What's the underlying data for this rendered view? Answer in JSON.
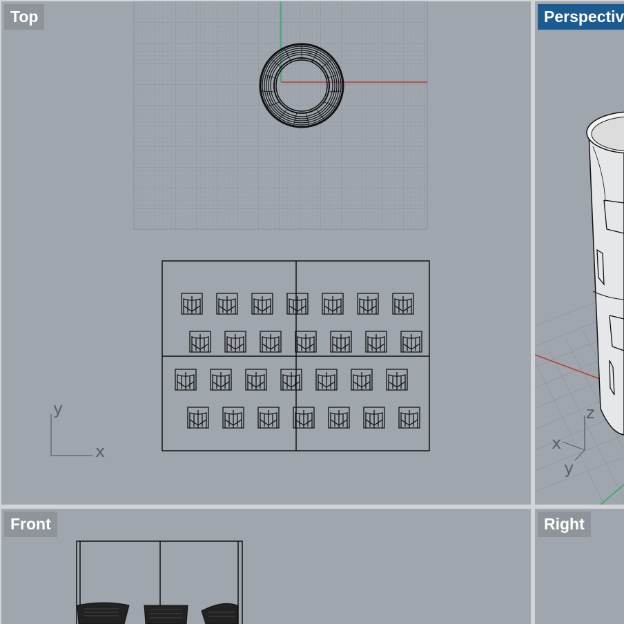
{
  "viewports": {
    "top": {
      "label": "Top",
      "active": false
    },
    "perspective": {
      "label": "Perspective",
      "active": true
    },
    "front": {
      "label": "Front",
      "active": false
    },
    "right": {
      "label": "Right",
      "active": false
    }
  },
  "axis_labels": {
    "top_x": "x",
    "top_y": "y",
    "persp_x": "x",
    "persp_y": "y",
    "persp_z": "z"
  },
  "colors": {
    "viewport_bg": "#a0a6ae",
    "active_label": "#1c5b92",
    "inactive_label": "#8f949a",
    "x_axis": "#c0392b",
    "y_axis": "#27ae60"
  },
  "pattern": {
    "rows": 4,
    "cells_per_row": 7
  }
}
